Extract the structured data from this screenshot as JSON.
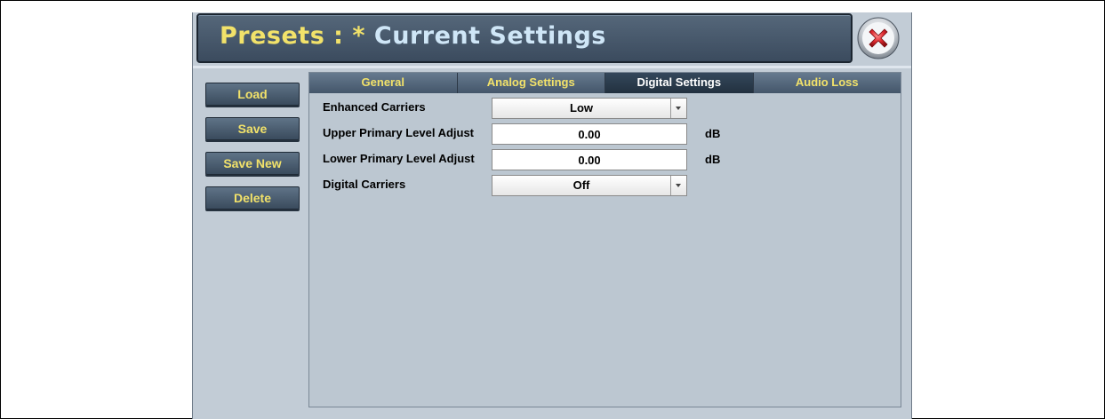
{
  "header": {
    "title_prefix": "Presets : * ",
    "title_current": "Current Settings"
  },
  "actions": [
    {
      "label": "Load"
    },
    {
      "label": "Save"
    },
    {
      "label": "Save New"
    },
    {
      "label": "Delete"
    }
  ],
  "tabs": [
    {
      "label": "General"
    },
    {
      "label": "Analog Settings"
    },
    {
      "label": "Digital Settings",
      "active": true
    },
    {
      "label": "Audio Loss"
    }
  ],
  "settings": {
    "enhanced_carriers": {
      "label": "Enhanced Carriers",
      "value": "Low"
    },
    "upper_primary": {
      "label": "Upper Primary Level Adjust",
      "value": "0.00",
      "unit": "dB"
    },
    "lower_primary": {
      "label": "Lower Primary Level Adjust",
      "value": "0.00",
      "unit": "dB"
    },
    "digital_carriers": {
      "label": "Digital Carriers",
      "value": "Off"
    }
  },
  "icons": {
    "close": "close-icon",
    "dropdown": "chevron-down-icon"
  },
  "colors": {
    "accent_text": "#f2e26a",
    "title_secondary": "#cfe6f7",
    "panel_bg": "#bcc7d1",
    "close_red": "#d8262e"
  }
}
